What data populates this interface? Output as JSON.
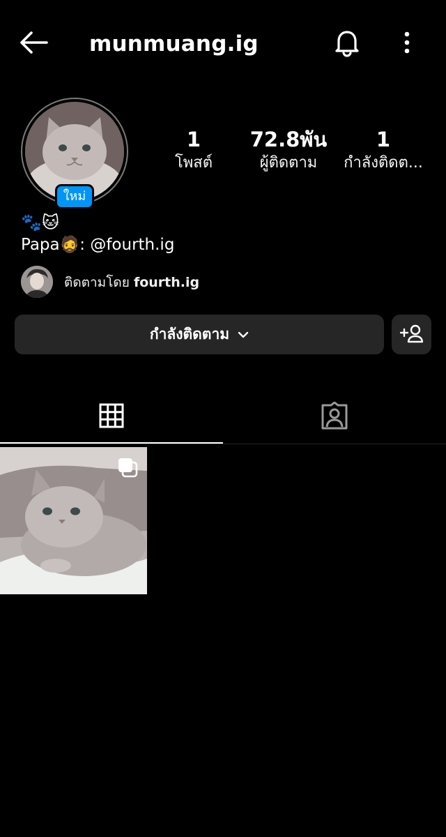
{
  "header": {
    "username": "munmuang.ig",
    "back_icon": "arrow-left-icon",
    "bell_icon": "bell-icon",
    "more_icon": "more-vertical-icon"
  },
  "profile": {
    "avatar": "cat-avatar",
    "new_badge": "ใหม่",
    "badge_color": "#0095f6"
  },
  "stats": {
    "posts": {
      "value": "1",
      "label": "โพสต์"
    },
    "followers": {
      "value": "72.8พัน",
      "label": "ผู้ติดตาม"
    },
    "following": {
      "value": "1",
      "label": "กำลังติดต..."
    }
  },
  "bio": {
    "emoji_line": "🐾🐱",
    "line2": "Papa🧔: @fourth.ig"
  },
  "followed_by": {
    "prefix": "ติดตามโดย",
    "user": "fourth.ig"
  },
  "actions": {
    "following_label": "กำลังติดตาม",
    "chevron_icon": "chevron-down-icon",
    "add_person_icon": "add-person-icon"
  },
  "tabs": [
    {
      "icon": "grid-icon",
      "active": true
    },
    {
      "icon": "tagged-person-icon",
      "active": false
    }
  ],
  "posts": [
    {
      "image": "cat-photo",
      "multi": true
    }
  ],
  "colors": {
    "background": "#000000",
    "button": "#262626",
    "accent": "#0095f6"
  }
}
